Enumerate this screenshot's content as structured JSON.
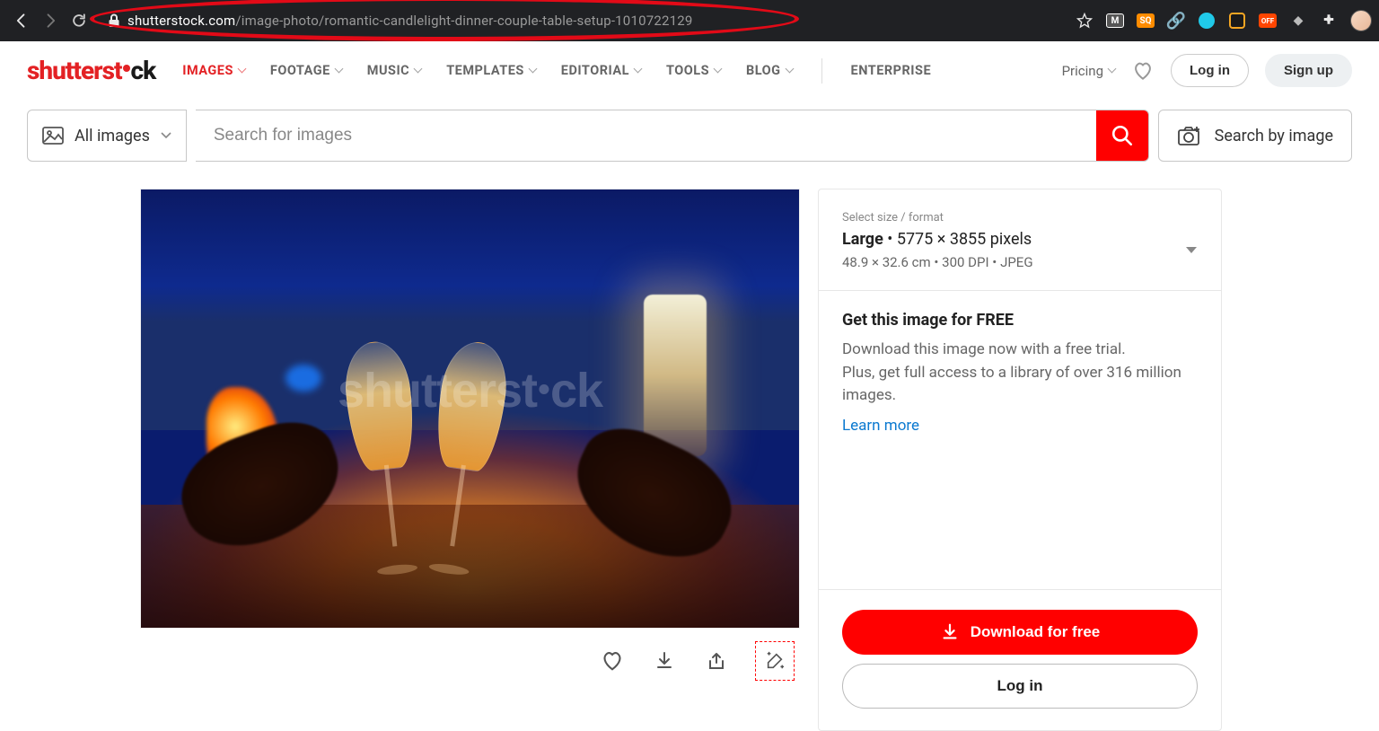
{
  "browser": {
    "url_host": "shutterstock.com",
    "url_path": "/image-photo/romantic-candlelight-dinner-couple-table-setup-1010722129",
    "ext_labels": {
      "m": "M",
      "sq": "SQ",
      "off": "OFF"
    }
  },
  "header": {
    "logo_a": "shutterst",
    "logo_b": "ck",
    "nav": [
      "IMAGES",
      "FOOTAGE",
      "MUSIC",
      "TEMPLATES",
      "EDITORIAL",
      "TOOLS",
      "BLOG"
    ],
    "enterprise": "ENTERPRISE",
    "pricing": "Pricing",
    "login": "Log in",
    "signup": "Sign up"
  },
  "search": {
    "category": "All images",
    "placeholder": "Search for images",
    "by_image": "Search by image"
  },
  "watermark": {
    "a": "shutterst",
    "b": "ck"
  },
  "panel": {
    "size_label": "Select size / format",
    "size_name": "Large",
    "size_dims": "5775 × 3855 pixels",
    "size_sub": "48.9 × 32.6 cm • 300 DPI • JPEG",
    "promo_h": "Get this image for FREE",
    "promo_p1": "Download this image now with a free trial.",
    "promo_p2": "Plus, get full access to a library of over 316 million images.",
    "learn": "Learn more",
    "download": "Download for free",
    "login": "Log in"
  }
}
